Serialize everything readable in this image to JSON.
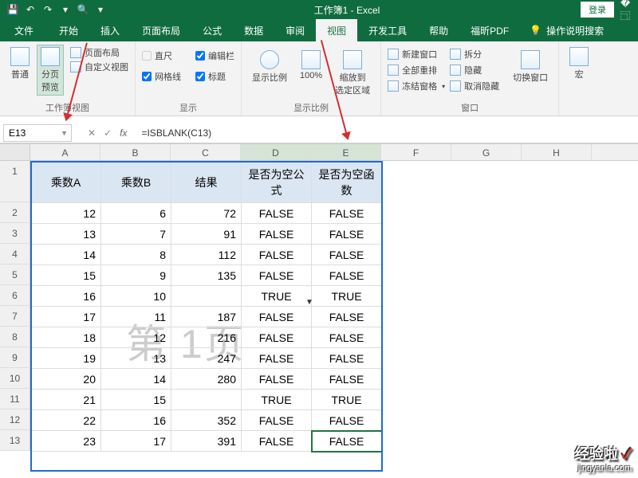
{
  "title": "工作簿1 - Excel",
  "login": "登录",
  "tabs": {
    "file": "文件",
    "home": "开始",
    "insert": "插入",
    "layout": "页面布局",
    "formula": "公式",
    "data": "数据",
    "review": "审阅",
    "view": "视图",
    "dev": "开发工具",
    "help": "帮助",
    "foxit": "福昕PDF",
    "tell": "操作说明搜索"
  },
  "ribbon": {
    "views": {
      "normal": "普通",
      "pagebreak": "分页\n预览",
      "pagelayout": "页面布局",
      "custom": "自定义视图",
      "label": "工作簿视图"
    },
    "show": {
      "ruler": "直尺",
      "formulabar": "编辑栏",
      "gridlines": "网格线",
      "headings": "标题",
      "label": "显示"
    },
    "zoom": {
      "zoom": "显示比例",
      "hundred": "100%",
      "selection": "缩放到\n选定区域",
      "label": "显示比例"
    },
    "window": {
      "new": "新建窗口",
      "arrange": "全部重排",
      "freeze": "冻结窗格",
      "split": "拆分",
      "hide": "隐藏",
      "unhide": "取消隐藏",
      "switch": "切换窗口",
      "label": "窗口"
    },
    "macro": "宏"
  },
  "namebox": "E13",
  "fx_label": "fx",
  "formula": "=ISBLANK(C13)",
  "columns": [
    "A",
    "B",
    "C",
    "D",
    "E",
    "F",
    "G",
    "H"
  ],
  "headers": {
    "a": "乘数A",
    "b": "乘数B",
    "c": "结果",
    "d": "是否为空公式",
    "e": "是否为空函数"
  },
  "watermark": "第 1页",
  "rows": [
    {
      "n": 2,
      "a": 12,
      "b": 6,
      "c": 72,
      "d": "FALSE",
      "e": "FALSE"
    },
    {
      "n": 3,
      "a": 13,
      "b": 7,
      "c": 91,
      "d": "FALSE",
      "e": "FALSE"
    },
    {
      "n": 4,
      "a": 14,
      "b": 8,
      "c": 112,
      "d": "FALSE",
      "e": "FALSE"
    },
    {
      "n": 5,
      "a": 15,
      "b": 9,
      "c": 135,
      "d": "FALSE",
      "e": "FALSE"
    },
    {
      "n": 6,
      "a": 16,
      "b": 10,
      "c": "",
      "d": "TRUE",
      "e": "TRUE"
    },
    {
      "n": 7,
      "a": 17,
      "b": 11,
      "c": 187,
      "d": "FALSE",
      "e": "FALSE"
    },
    {
      "n": 8,
      "a": 18,
      "b": 12,
      "c": 216,
      "d": "FALSE",
      "e": "FALSE"
    },
    {
      "n": 9,
      "a": 19,
      "b": 13,
      "c": 247,
      "d": "FALSE",
      "e": "FALSE"
    },
    {
      "n": 10,
      "a": 20,
      "b": 14,
      "c": 280,
      "d": "FALSE",
      "e": "FALSE"
    },
    {
      "n": 11,
      "a": 21,
      "b": 15,
      "c": "",
      "d": "TRUE",
      "e": "TRUE"
    },
    {
      "n": 12,
      "a": 22,
      "b": 16,
      "c": 352,
      "d": "FALSE",
      "e": "FALSE"
    },
    {
      "n": 13,
      "a": 23,
      "b": 17,
      "c": 391,
      "d": "FALSE",
      "e": "FALSE"
    }
  ],
  "jyl": {
    "brand": "经验啦",
    "url": "jingyanla.com",
    "check": "✓"
  }
}
